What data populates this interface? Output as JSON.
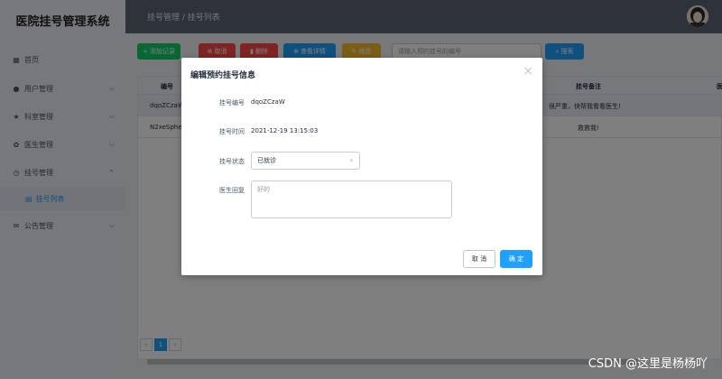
{
  "app": {
    "title": "医院挂号管理系统"
  },
  "sidebar": {
    "items": [
      {
        "label": "首页",
        "icon": "grid-icon",
        "glyph": "▦"
      },
      {
        "label": "用户管理",
        "icon": "info-icon",
        "glyph": "●"
      },
      {
        "label": "科室管理",
        "icon": "star-icon",
        "glyph": "★"
      },
      {
        "label": "医生管理",
        "icon": "gear-icon",
        "glyph": "✿"
      },
      {
        "label": "挂号管理",
        "icon": "clock-icon",
        "glyph": "◷"
      },
      {
        "label": "挂号列表",
        "icon": "doc-icon",
        "glyph": "▤"
      },
      {
        "label": "公告管理",
        "icon": "mail-icon",
        "glyph": "✉"
      }
    ]
  },
  "header": {
    "breadcrumb": "挂号管理 / 挂号列表"
  },
  "toolbar": {
    "add": "添加记录",
    "cancel": "取消",
    "delete": "删除",
    "view": "查看详情",
    "edit": "修改",
    "search_placeholder": "请输入预约挂号的编号",
    "search": "搜索"
  },
  "table": {
    "columns": [
      "编号",
      "挂号备注",
      "医"
    ],
    "rows": [
      {
        "id": "dqoZCzaW",
        "note": "很严重，快帮我看看医生!"
      },
      {
        "id": "N2xeSphe",
        "note": "救救我!"
      }
    ]
  },
  "pagination": {
    "prev": "‹",
    "current": "1",
    "next": "›"
  },
  "dialog": {
    "title": "编辑预约挂号信息",
    "fields": {
      "id_label": "挂号编号",
      "id_value": "dqoZCzaW",
      "time_label": "挂号时间",
      "time_value": "2021-12-19 13:15:03",
      "status_label": "挂号状态",
      "status_value": "已就诊",
      "reply_label": "医生回复",
      "reply_value": "好的"
    },
    "cancel": "取 消",
    "ok": "确 定"
  },
  "watermark": "CSDN @这里是杨杨吖",
  "colors": {
    "primary": "#20a0ff",
    "success": "#13ce66",
    "danger": "#ff4949",
    "warning": "#f7ba2a",
    "header": "#5a6577",
    "sidebar": "#eef1f6"
  }
}
